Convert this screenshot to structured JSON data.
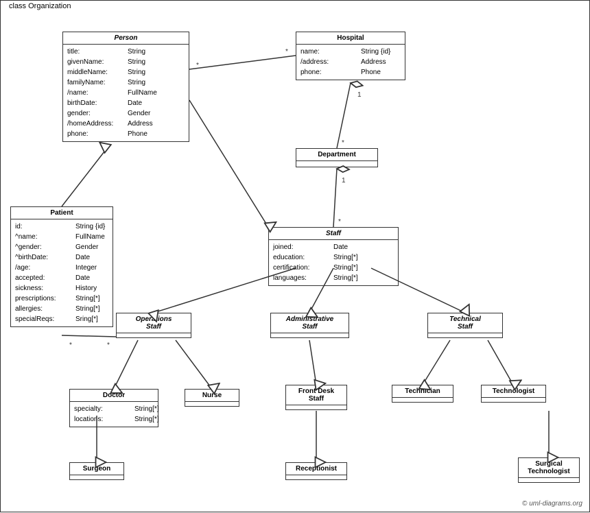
{
  "diagram": {
    "title": "class Organization",
    "classes": {
      "person": {
        "name": "Person",
        "italic": true,
        "attributes": [
          {
            "name": "title:",
            "type": "String"
          },
          {
            "name": "givenName:",
            "type": "String"
          },
          {
            "name": "middleName:",
            "type": "String"
          },
          {
            "name": "familyName:",
            "type": "String"
          },
          {
            "name": "/name:",
            "type": "FullName"
          },
          {
            "name": "birthDate:",
            "type": "Date"
          },
          {
            "name": "gender:",
            "type": "Gender"
          },
          {
            "name": "/homeAddress:",
            "type": "Address"
          },
          {
            "name": "phone:",
            "type": "Phone"
          }
        ]
      },
      "hospital": {
        "name": "Hospital",
        "italic": false,
        "attributes": [
          {
            "name": "name:",
            "type": "String {id}"
          },
          {
            "name": "/address:",
            "type": "Address"
          },
          {
            "name": "phone:",
            "type": "Phone"
          }
        ]
      },
      "department": {
        "name": "Department",
        "italic": false,
        "attributes": []
      },
      "staff": {
        "name": "Staff",
        "italic": true,
        "attributes": [
          {
            "name": "joined:",
            "type": "Date"
          },
          {
            "name": "education:",
            "type": "String[*]"
          },
          {
            "name": "certification:",
            "type": "String[*]"
          },
          {
            "name": "languages:",
            "type": "String[*]"
          }
        ]
      },
      "patient": {
        "name": "Patient",
        "italic": false,
        "attributes": [
          {
            "name": "id:",
            "type": "String {id}"
          },
          {
            "name": "^name:",
            "type": "FullName"
          },
          {
            "name": "^gender:",
            "type": "Gender"
          },
          {
            "name": "^birthDate:",
            "type": "Date"
          },
          {
            "name": "/age:",
            "type": "Integer"
          },
          {
            "name": "accepted:",
            "type": "Date"
          },
          {
            "name": "sickness:",
            "type": "History"
          },
          {
            "name": "prescriptions:",
            "type": "String[*]"
          },
          {
            "name": "allergies:",
            "type": "String[*]"
          },
          {
            "name": "specialReqs:",
            "type": "Sring[*]"
          }
        ]
      },
      "operations_staff": {
        "name": "Operations\nStaff",
        "italic": true,
        "attributes": []
      },
      "administrative_staff": {
        "name": "Administrative\nStaff",
        "italic": true,
        "attributes": []
      },
      "technical_staff": {
        "name": "Technical\nStaff",
        "italic": true,
        "attributes": []
      },
      "doctor": {
        "name": "Doctor",
        "italic": false,
        "attributes": [
          {
            "name": "specialty:",
            "type": "String[*]"
          },
          {
            "name": "locations:",
            "type": "String[*]"
          }
        ]
      },
      "nurse": {
        "name": "Nurse",
        "italic": false,
        "attributes": []
      },
      "front_desk_staff": {
        "name": "Front Desk\nStaff",
        "italic": false,
        "attributes": []
      },
      "technician": {
        "name": "Technician",
        "italic": false,
        "attributes": []
      },
      "technologist": {
        "name": "Technologist",
        "italic": false,
        "attributes": []
      },
      "surgeon": {
        "name": "Surgeon",
        "italic": false,
        "attributes": []
      },
      "receptionist": {
        "name": "Receptionist",
        "italic": false,
        "attributes": []
      },
      "surgical_technologist": {
        "name": "Surgical\nTechnologist",
        "italic": false,
        "attributes": []
      }
    },
    "copyright": "© uml-diagrams.org"
  }
}
